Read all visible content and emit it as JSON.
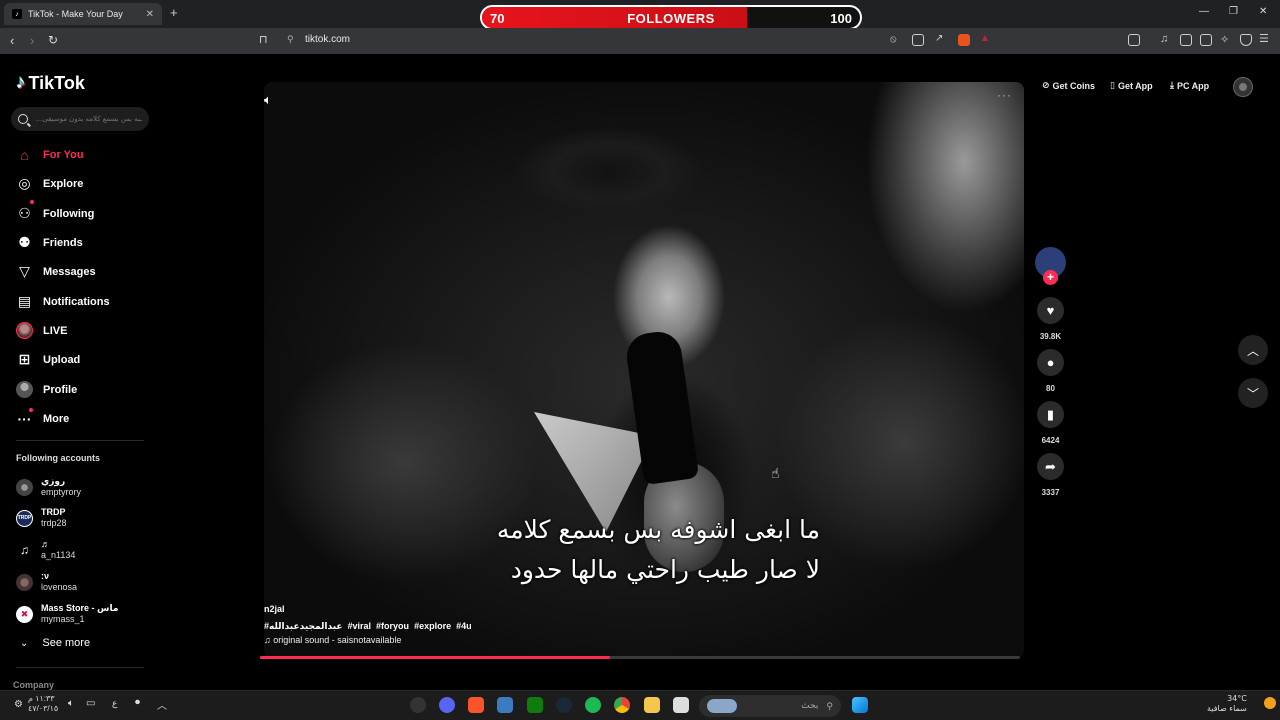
{
  "browser": {
    "tab_title": "TikTok - Make Your Day",
    "url": "tiktok.com"
  },
  "followers_goal": {
    "current": "70",
    "label": "FOLLOWERS",
    "target": "100",
    "progress": 0.7
  },
  "sidebar": {
    "brand": "TikTok",
    "search_placeholder": "ـبه بس بسمع كلامه بدون موسيقى...",
    "nav": [
      {
        "label": "For You",
        "icon": "home-icon"
      },
      {
        "label": "Explore",
        "icon": "compass-icon"
      },
      {
        "label": "Following",
        "icon": "following-icon"
      },
      {
        "label": "Friends",
        "icon": "friends-icon"
      },
      {
        "label": "Messages",
        "icon": "messages-icon"
      },
      {
        "label": "Notifications",
        "icon": "notifications-icon"
      },
      {
        "label": "LIVE",
        "icon": "live-icon"
      },
      {
        "label": "Upload",
        "icon": "upload-icon"
      },
      {
        "label": "Profile",
        "icon": "profile-icon"
      },
      {
        "label": "More",
        "icon": "more-icon"
      }
    ],
    "following_title": "Following accounts",
    "accounts": [
      {
        "display": "روزي",
        "user": "emptyrory"
      },
      {
        "display": "TRDP",
        "user": "trdp28"
      },
      {
        "display": "♬",
        "user": "a_n1134"
      },
      {
        "display": ":ν",
        "user": "lovenosa"
      },
      {
        "display": "Mass Store - ماس",
        "user": "mymass_1"
      }
    ],
    "see_more": "See more",
    "company": "Company"
  },
  "topbar": {
    "get_coins": "Get Coins",
    "get_app": "Get App",
    "pc_app": "PC App"
  },
  "video": {
    "subtitle_line1": "ما ابغى اشوفه بس بسمع كلامه",
    "subtitle_line2": "لا صار طيب راحتي مالها حدود",
    "author": "n2jal",
    "tags": [
      "#عبدالمجيدعبدالله",
      "#viral",
      "#foryou",
      "#explore",
      "#4u"
    ],
    "sound": "original sound - saisnotavailable",
    "progress": 0.46
  },
  "actions": {
    "likes": "39.8K",
    "comments": "80",
    "saves": "6424",
    "shares": "3337"
  },
  "taskbar": {
    "time": "١١:٣٣ م",
    "date": "٤٧/٠٣/١٥",
    "search_label": "بحث",
    "temperature": "34°C",
    "weather": "سماء صافية"
  }
}
